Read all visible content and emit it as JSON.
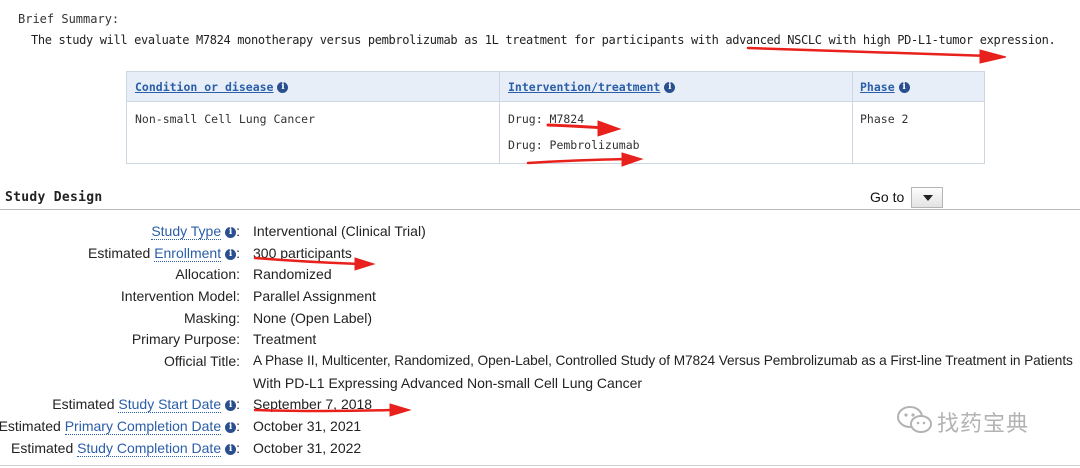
{
  "brief_summary": {
    "label": "Brief Summary:",
    "text": "The study will evaluate M7824 monotherapy versus pembrolizumab as 1L treatment for participants with advanced NSCLC with high PD-L1-tumor expression."
  },
  "conditions_table": {
    "headers": [
      "Condition or disease",
      "Intervention/treatment",
      "Phase"
    ],
    "condition": "Non-small Cell Lung Cancer",
    "interventions": [
      "Drug: M7824",
      "Drug: Pembrolizumab"
    ],
    "phase": "Phase 2"
  },
  "study_design": {
    "title": "Study Design",
    "goto_label": "Go to",
    "rows": [
      {
        "label_prefix": "",
        "label_link": "Study Type",
        "value": "Interventional  (Clinical Trial)"
      },
      {
        "label_prefix": "Estimated ",
        "label_link": "Enrollment",
        "value": "300 participants"
      },
      {
        "label_prefix": "Allocation:",
        "label_link": "",
        "value": "Randomized"
      },
      {
        "label_prefix": "Intervention Model:",
        "label_link": "",
        "value": "Parallel Assignment"
      },
      {
        "label_prefix": "Masking:",
        "label_link": "",
        "value": "None (Open Label)"
      },
      {
        "label_prefix": "Primary Purpose:",
        "label_link": "",
        "value": "Treatment"
      },
      {
        "label_prefix": "Official Title:",
        "label_link": "",
        "value": "A Phase II, Multicenter, Randomized, Open-Label, Controlled Study of M7824 Versus Pembrolizumab as a First-line Treatment in Patients",
        "value_line2": "With PD-L1 Expressing Advanced Non-small Cell Lung Cancer"
      },
      {
        "label_prefix": "Estimated ",
        "label_link": "Study Start Date",
        "value": "September 7, 2018"
      },
      {
        "label_prefix": "Estimated ",
        "label_link": "Primary Completion Date",
        "value": "October 31, 2021"
      },
      {
        "label_prefix": "Estimated ",
        "label_link": "Study Completion Date",
        "value": "October 31, 2022"
      }
    ]
  },
  "watermark": {
    "text": "找药宝典",
    "icon": "wechat-icon"
  },
  "annotation_color": "#e8211c"
}
